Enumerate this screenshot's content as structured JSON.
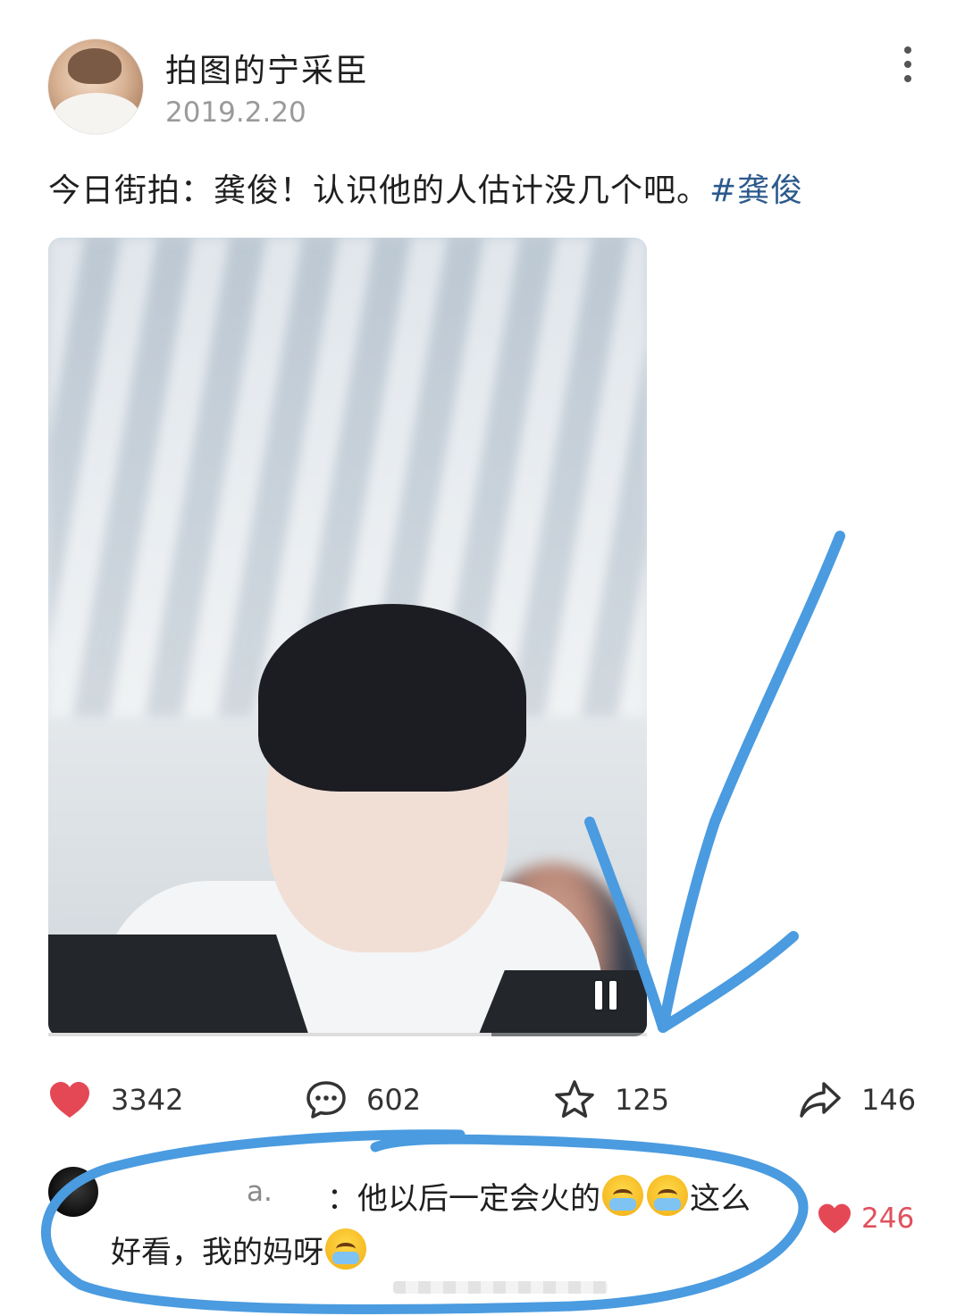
{
  "post": {
    "username": "拍图的宁采臣",
    "date": "2019.2.20",
    "text": "今日街拍：龚俊！认识他的人估计没几个吧。",
    "hashtag": "#龚俊"
  },
  "media": {
    "type": "video",
    "state": "playing",
    "progress": 0.74
  },
  "actions": {
    "likes": "3342",
    "comments": "602",
    "favorites": "125",
    "shares": "146"
  },
  "comment": {
    "author": "a.",
    "text_line1": "：他以后一定会火的",
    "text_line1_end": "这么",
    "text_line2": "好看，我的妈呀",
    "likes": "246"
  },
  "colors": {
    "hashtag": "#2c5a8c",
    "like_red": "#e54855",
    "annotation_blue": "#4a9be0"
  },
  "icons": [
    "more-vertical-icon",
    "pause-icon",
    "heart-icon",
    "comment-bubble-icon",
    "star-icon",
    "share-arrow-icon",
    "crying-emoji"
  ]
}
